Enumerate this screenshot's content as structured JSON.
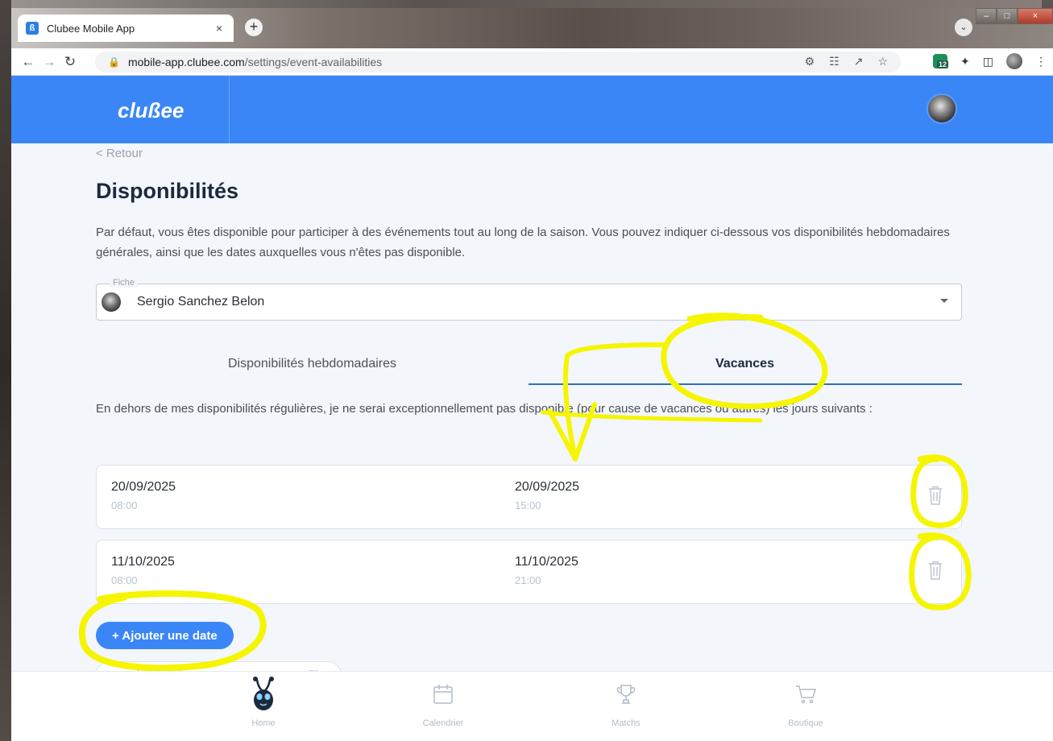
{
  "browser": {
    "tab_title": "Clubee Mobile App",
    "tab_close": "×",
    "new_tab": "+",
    "url_host": "mobile-app.clubee.com",
    "url_path": "/settings/event-availabilities",
    "extension_badge": "12"
  },
  "header": {
    "logo": "clußee"
  },
  "page": {
    "back": "< Retour",
    "title": "Disponibilités",
    "intro": "Par défaut, vous êtes disponible pour participer à des événements tout au long de la saison. Vous pouvez indiquer ci-dessous vos disponibilités hebdomadaires générales, ainsi que les dates auxquelles vous n'êtes pas disponible.",
    "profile_select": {
      "legend": "Fiche",
      "value": "Sergio Sanchez Belon"
    },
    "tabs": [
      {
        "label": "Disponibilités hebdomadaires",
        "active": false
      },
      {
        "label": "Vacances",
        "active": true
      }
    ],
    "note": "En dehors de mes disponibilités régulières, je ne serai exceptionnellement pas disponible (pour cause de vacances ou autres) les jours suivants :",
    "unavailable_dates": [
      {
        "start_date": "20/09/2025",
        "start_time": "08:00",
        "end_date": "20/09/2025",
        "end_time": "15:00"
      },
      {
        "start_date": "11/10/2025",
        "start_time": "08:00",
        "end_date": "11/10/2025",
        "end_time": "21:00"
      }
    ],
    "add_date_label": "+ Ajouter une date",
    "copy_dates_label": "Copier les dates sur tous mes profils"
  },
  "bottom_nav": [
    {
      "label": "Home",
      "icon": "bee-mascot-icon"
    },
    {
      "label": "Calendrier",
      "icon": "calendar-icon"
    },
    {
      "label": "Matchs",
      "icon": "trophy-icon"
    },
    {
      "label": "Boutique",
      "icon": "cart-icon"
    }
  ],
  "colors": {
    "brand_blue": "#3b86f7",
    "highlighter": "#f5f500",
    "tab_underline": "#2f6fc2"
  }
}
